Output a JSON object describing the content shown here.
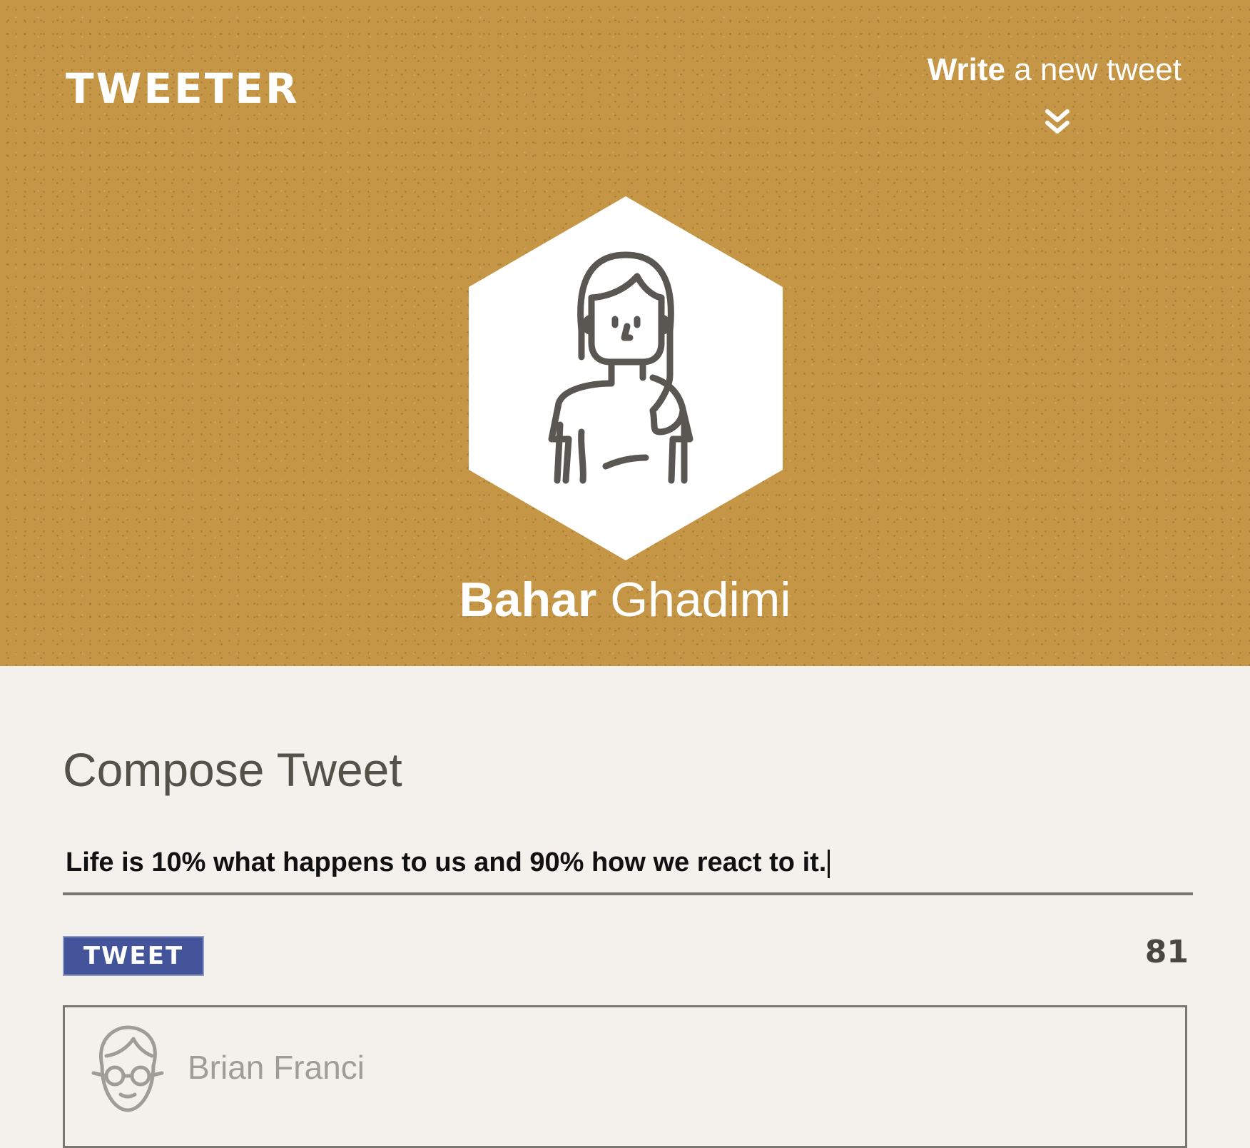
{
  "app": {
    "logo": "TWEETER"
  },
  "nav": {
    "write_bold": "Write",
    "write_rest": " a new tweet",
    "toggle_icon": "double-chevron-down-icon"
  },
  "profile": {
    "first_name": "Bahar",
    "last_name": "Ghadimi",
    "avatar_icon": "woman-avatar-icon"
  },
  "compose": {
    "title": "Compose Tweet",
    "text": "Life is 10% what happens to us and 90% how we react to it.",
    "button_label": "TWEET",
    "counter": "81"
  },
  "tweets": [
    {
      "author": "Brian Franci",
      "avatar_icon": "man-with-glasses-avatar-icon"
    }
  ],
  "colors": {
    "header_bg": "#c49645",
    "page_bg": "#f4f1ed",
    "button_bg": "#43549a",
    "text_dark": "#545149"
  }
}
